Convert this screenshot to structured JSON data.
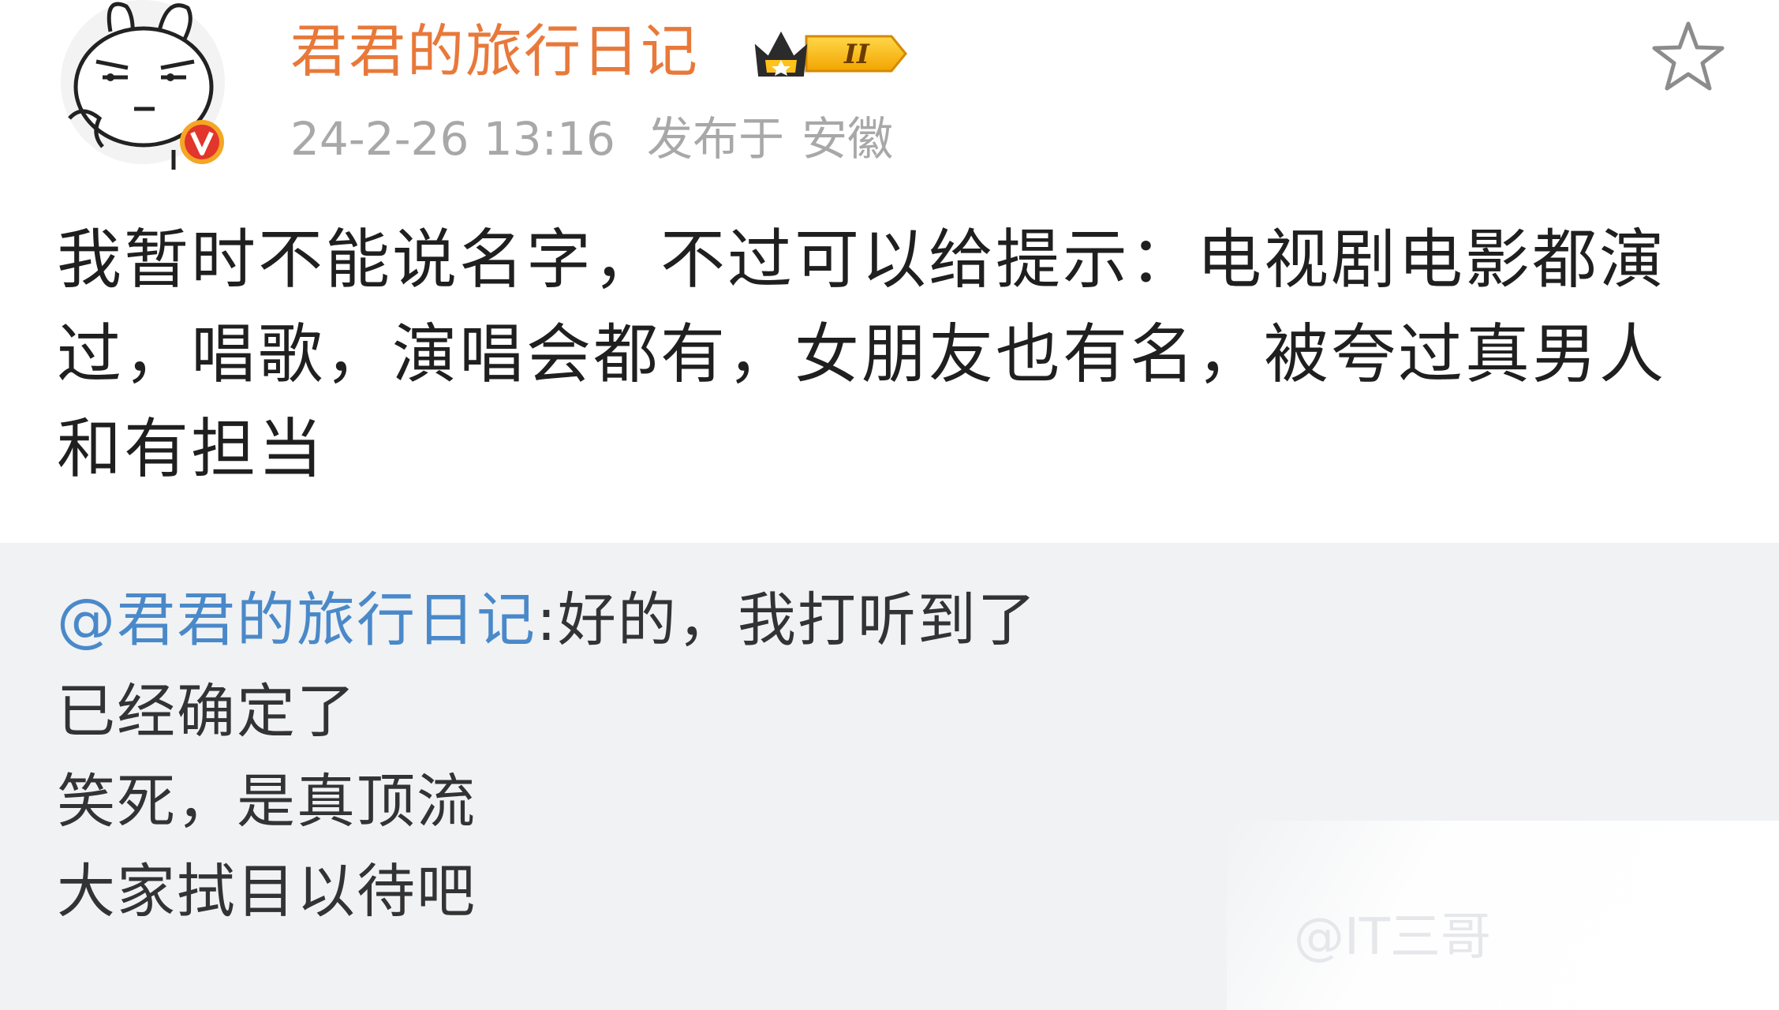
{
  "post": {
    "author": "君君的旅行日记",
    "vip_level": "II",
    "timestamp": "24-2-26 13:16",
    "location_prefix": "发布于",
    "location": "安徽",
    "text": "我暂时不能说名字，不过可以给提示：电视剧电影都演过，唱歌，演唱会都有，女朋友也有名，被夸过真男人和有担当"
  },
  "repost": {
    "mention": "@君君的旅行日记",
    "first_line_rest": ":好的，我打听到了",
    "lines": [
      "已经确定了",
      "笑死，是真顶流",
      "大家拭目以待吧"
    ]
  },
  "watermark": "@IT三哥",
  "icons": {
    "avatar": "cartoon-rabbit-avatar",
    "verified": "verified-v-badge",
    "vip": "vip-crown-badge",
    "favorite": "star-outline-icon"
  },
  "colors": {
    "author": "#e8793a",
    "mention": "#4a89c9",
    "meta": "#a8a8a8",
    "repost_bg": "#f1f2f4"
  }
}
